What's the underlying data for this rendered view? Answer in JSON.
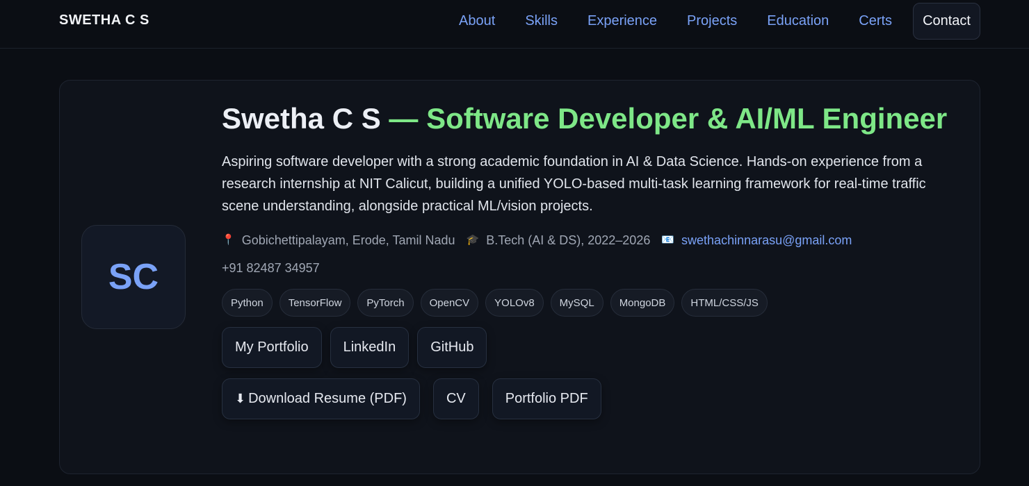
{
  "header": {
    "brand": "SWETHA C S",
    "nav": [
      "About",
      "Skills",
      "Experience",
      "Projects",
      "Education",
      "Certs",
      "Contact"
    ]
  },
  "profile": {
    "avatar_initials": "SC",
    "name": "Swetha C S",
    "separator": " — ",
    "role": "Software Developer & AI/ML Engineer",
    "bio": "Aspiring software developer with a strong academic foundation in AI & Data Science. Hands-on experience from a research internship at NIT Calicut, building a unified YOLO-based multi-task learning framework for real-time traffic scene understanding, alongside practical ML/vision projects.",
    "location": "Gobichettipalayam, Erode, Tamil Nadu",
    "degree": "B.Tech (AI & DS), 2022–2026",
    "email": "swethachinnarasu@gmail.com",
    "phone": "+91 82487 34957"
  },
  "skills": [
    "Python",
    "TensorFlow",
    "PyTorch",
    "OpenCV",
    "YOLOv8",
    "MySQL",
    "MongoDB",
    "HTML/CSS/JS"
  ],
  "links": [
    "My Portfolio",
    "LinkedIn",
    "GitHub"
  ],
  "downloads": {
    "resume_icon": "⬇",
    "resume": "Download Resume (PDF)",
    "cv": "CV",
    "portfolio_pdf": "Portfolio PDF"
  },
  "icons": {
    "location": "pin-icon",
    "degree": "graduation-cap-icon",
    "email": "email-icon"
  },
  "colors": {
    "background": "#0b0e14",
    "accent_blue": "#7aa2f7",
    "accent_green": "#7ee787"
  }
}
